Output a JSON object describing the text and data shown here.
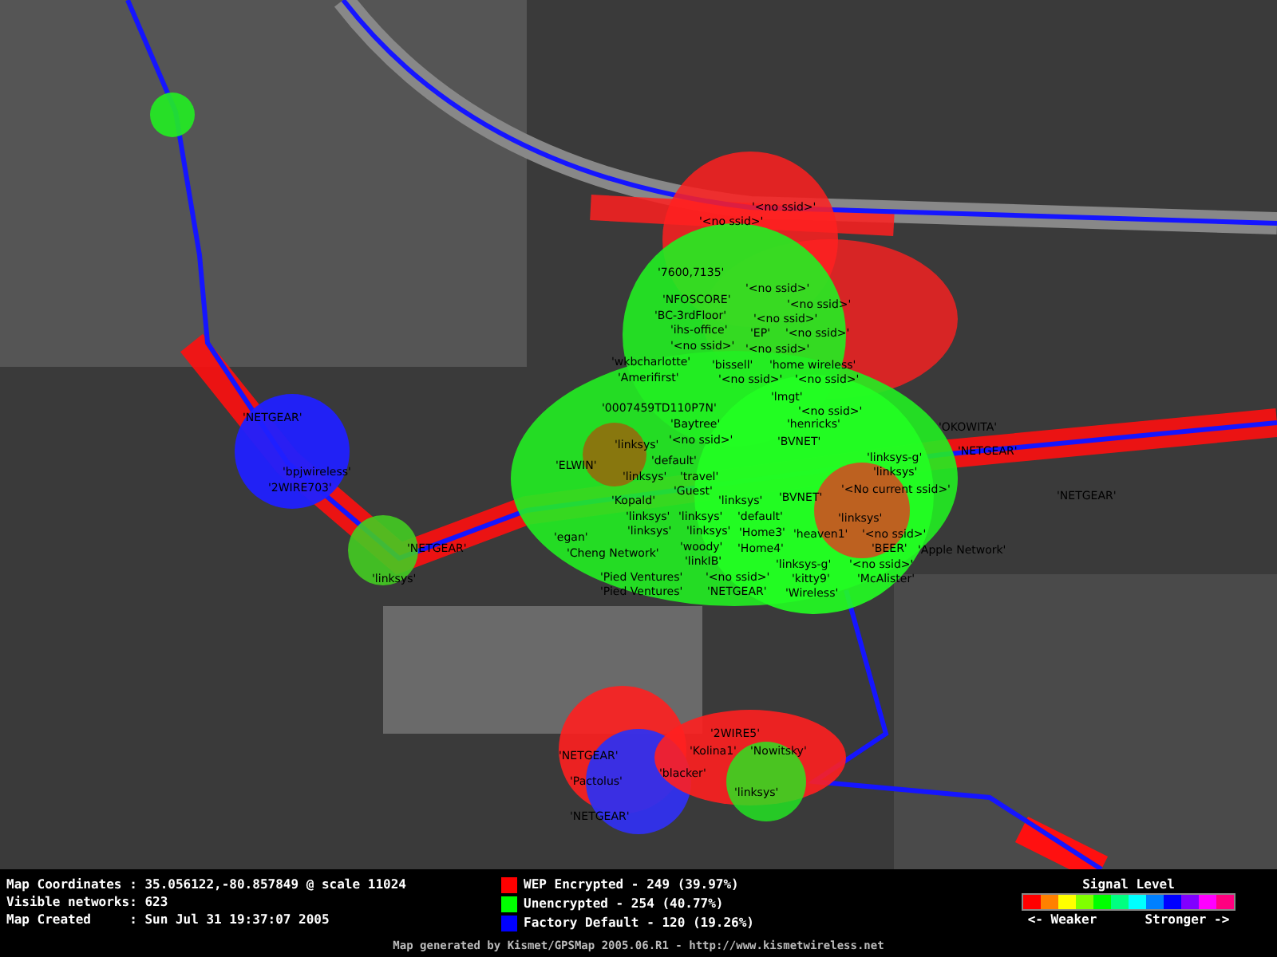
{
  "map": {
    "network_labels": [
      "'<no ssid>'",
      "'<no ssid>'",
      "'7600,7135'",
      "'<no ssid>'",
      "'NFOSCORE'",
      "'<no ssid>'",
      "'BC-3rdFloor'",
      "'<no ssid>'",
      "'ihs-office'",
      "'EP'",
      "'<no ssid>'",
      "'<no ssid>'",
      "'<no ssid>'",
      "'wkbcharlotte'",
      "'bissell'",
      "'home wireless'",
      "'Amerifirst'",
      "'<no ssid>'",
      "'<no ssid>'",
      "'0007459TD110P7N'",
      "'lmgt'",
      "'<no ssid>'",
      "'Baytree'",
      "'henricks'",
      "'linksys'",
      "'<no ssid>'",
      "'BVNET'",
      "'ELWIN'",
      "'default'",
      "'linksys-g'",
      "'linksys'",
      "'travel'",
      "'linksys'",
      "'Guest'",
      "'linksys'",
      "'BVNET'",
      "'<No current ssid>'",
      "'Kopald'",
      "'linksys'",
      "'linksys'",
      "'default'",
      "'linksys'",
      "'egan'",
      "'linksys'",
      "'linksys'",
      "'Home3'",
      "'heaven1'",
      "'<no ssid>'",
      "'Cheng Network'",
      "'woody'",
      "'Home4'",
      "'BEER'",
      "'linkIB'",
      "'linksys-g'",
      "'<no ssid>'",
      "'Pied Ventures'",
      "'<no ssid>'",
      "'kitty9'",
      "'McAlister'",
      "'Pied Ventures'",
      "'NETGEAR'",
      "'Wireless'",
      "'OKOWITA'",
      "'NETGEAR'",
      "'Apple Network'",
      "'NETGEAR'",
      "'NETGEAR'",
      "'bpjwireless'",
      "'2WIRE703'",
      "'NETGEAR'",
      "'linksys'",
      "'2WIRE5'",
      "'NETGEAR'",
      "'Kolina1'",
      "'Nowitsky'",
      "'Pactolus'",
      "'blacker'",
      "'linksys'",
      "'NETGEAR'"
    ]
  },
  "info": {
    "lines": [
      {
        "label": "Map Coordinates ",
        "value": ": 35.056122,-80.857849 @ scale 11024"
      },
      {
        "label": "Visible networks",
        "value": ": 623"
      },
      {
        "label": "Map Created     ",
        "value": ": Sun Jul 31 19:37:07 2005"
      }
    ]
  },
  "legend": [
    {
      "label": "WEP Encrypted - 249 (39.97%)",
      "color": "#ff0000"
    },
    {
      "label": "Unencrypted - 254 (40.77%)",
      "color": "#00ff00"
    },
    {
      "label": "Factory Default - 120 (19.26%)",
      "color": "#0000ff"
    }
  ],
  "signal": {
    "title": "Signal Level",
    "weaker": "<- Weaker",
    "stronger": "Stronger ->"
  },
  "footer": "Map generated by Kismet/GPSMap 2005.06.R1 - http://www.kismetwireless.net"
}
